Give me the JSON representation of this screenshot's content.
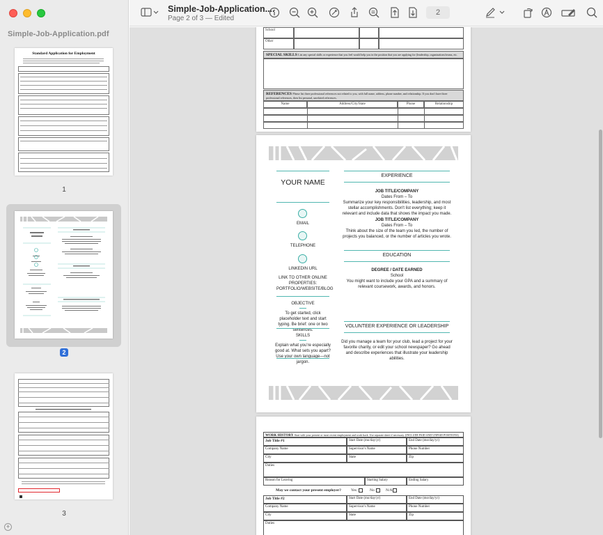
{
  "window": {
    "doc_title": "Simple-Job-Application....",
    "doc_subtitle": "Page 2 of 3 — Edited",
    "page_number": "2"
  },
  "sidebar": {
    "title": "Simple-Job-Application.pdf",
    "thumbnails": [
      {
        "label": "1",
        "heading": "Standard Application for Employment"
      },
      {
        "label": "2",
        "selected": true
      },
      {
        "label": "3"
      }
    ]
  },
  "toolbar": {
    "icons": [
      "sidebar-toggle-icon",
      "info-icon",
      "zoom-out-icon",
      "zoom-in-icon",
      "markup-icon",
      "share-icon",
      "search-text-icon",
      "insert-page-icon",
      "export-icon",
      "pen-icon",
      "rotate-icon",
      "sign-icon",
      "form-icon",
      "search-icon"
    ]
  },
  "page1": {
    "rows": [
      "School",
      "Other"
    ],
    "special_skills_heading": "SPECIAL SKILLS",
    "special_skills_hint": "List any special skills or experience that you feel would help you in the position that you are applying for (leadership, organizations/teams, etc.",
    "references_heading": "REFERENCES",
    "references_hint": "Please list three professional references not related to you, with full name, address, phone number, and relationship. If you don't have three professional references, then list personal, unrelated references.",
    "ref_columns": [
      "Name",
      "Address/City/State",
      "Phone",
      "Relationship"
    ]
  },
  "resume": {
    "name": "YOUR NAME",
    "contact": [
      "EMAIL",
      "TELEPHONE",
      "LINKEDIN URL"
    ],
    "other_links": "LINK TO OTHER ONLINE PROPERTIES: PORTFOLIO/WEBSITE/BLOG",
    "objective_heading": "OBJECTIVE",
    "objective_text": "To get started, click placeholder text and start typing. Be brief: one or two sentences.",
    "skills_heading": "SKILLS",
    "skills_text": "Explain what you're especially good at. What sets you apart? Use your own language—not jargon.",
    "experience_heading": "EXPERIENCE",
    "jobs": [
      {
        "title": "JOB TITLE/COMPANY",
        "dates": "Dates From – To",
        "desc": "Summarize your key responsibilities, leadership, and most stellar accomplishments. Don't list everything; keep it relevant and include data that shows the impact you made."
      },
      {
        "title": "JOB TITLE/COMPANY",
        "dates": "Dates From – To",
        "desc": "Think about the size of the team you led, the number of projects you balanced, or the number of articles you wrote."
      }
    ],
    "education_heading": "EDUCATION",
    "degree": "DEGREE / DATE EARNED",
    "school": "School",
    "education_text": "You might want to include your GPA and a summary of relevant coursework, awards, and honors.",
    "volunteer_heading": "VOLUNTEER EXPERIENCE OR LEADERSHIP",
    "volunteer_text": "Did you manage a team for your club, lead a project for your favorite charity, or edit your school newspaper? Go ahead and describe experiences that illustrate your leadership abilities."
  },
  "page3": {
    "work_history_heading": "WORK HISTORY",
    "work_history_hint": "Start with your present or most recent employment and work back. Use separate sheet if necessary. (INCLUDE PAID AND UNPAID POSITIONS)",
    "job1": "Job Title #1",
    "start_date": "Start Date (mo/day/yr)",
    "end_date": "End Date (mo/day/yr)",
    "company_name": "Company Name",
    "supervisor": "Supervisor's Name",
    "phone": "Phone Number",
    "city": "City",
    "state": "State",
    "zip": "Zip",
    "duties": "Duties",
    "reason": "Reason for Leaving",
    "starting_salary": "Starting Salary",
    "ending_salary": "Ending Salary",
    "contact_question": "May we contact your present employer?",
    "yes": "Yes",
    "no": "No",
    "na": "N/A",
    "job2": "Job Title #2"
  }
}
